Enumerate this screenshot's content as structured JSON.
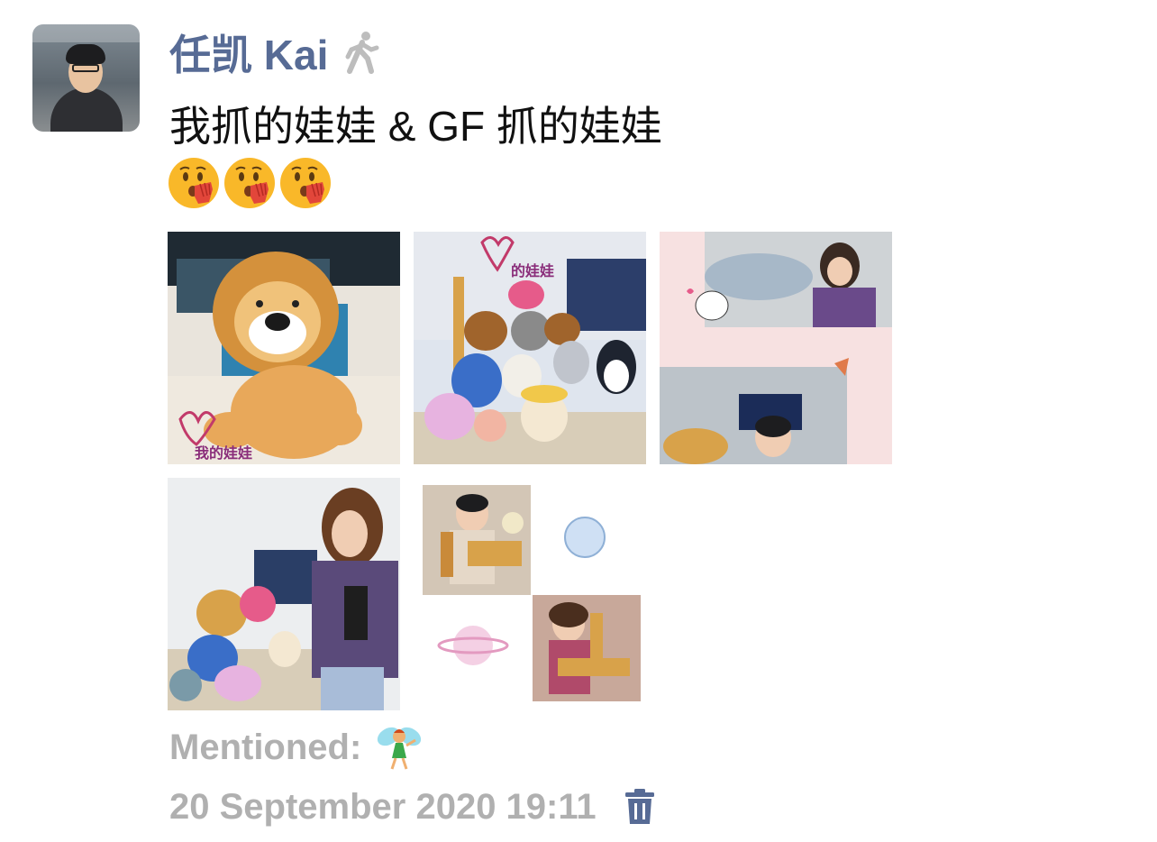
{
  "post": {
    "author": "任凯 Kai",
    "text": "我抓的娃娃 & GF 抓的娃娃",
    "emojis": [
      "hushed-face-hand-emoji",
      "hushed-face-hand-emoji",
      "hushed-face-hand-emoji"
    ],
    "author_icon": "walking-person-icon",
    "photos": [
      {
        "caption": "我的娃娃"
      },
      {
        "caption": "的娃娃"
      },
      {
        "caption": ""
      },
      {
        "caption": ""
      },
      {
        "caption": ""
      }
    ],
    "mentioned_label": "Mentioned:",
    "mentioned_icon": "fairy-emoji",
    "timestamp": "20 September 2020 19:11",
    "delete_icon": "trash-icon"
  },
  "colors": {
    "author_name": "#576b95",
    "muted_text": "#b0b0b0",
    "body_text": "#111111"
  }
}
